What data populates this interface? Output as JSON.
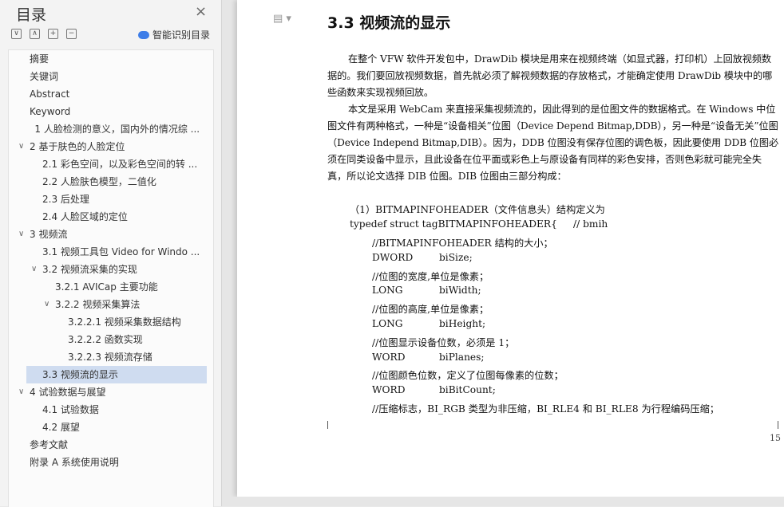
{
  "sidebar": {
    "title": "目录",
    "close_icon": "close-icon",
    "tools": [
      "expand-icon",
      "collapse-icon",
      "plus-icon",
      "minus-icon"
    ],
    "smart_label": "智能识别目录",
    "items": [
      {
        "label": "摘要",
        "level": 0,
        "arrow": ""
      },
      {
        "label": "关键词",
        "level": 0,
        "arrow": ""
      },
      {
        "label": "Abstract",
        "level": 0,
        "arrow": ""
      },
      {
        "label": "Keyword",
        "level": 0,
        "arrow": ""
      },
      {
        "label": "1 人脸检测的意义，国内外的情况综 ...",
        "level": 0.4,
        "arrow": ""
      },
      {
        "label": "2  基于肤色的人脸定位",
        "level": 0,
        "arrow": "∨"
      },
      {
        "label": "2.1 彩色空间，以及彩色空间的转 ...",
        "level": 1,
        "arrow": ""
      },
      {
        "label": "2.2 人脸肤色模型，二值化",
        "level": 1,
        "arrow": ""
      },
      {
        "label": "2.3 后处理",
        "level": 1,
        "arrow": ""
      },
      {
        "label": "2.4 人脸区域的定位",
        "level": 1,
        "arrow": ""
      },
      {
        "label": "3 视频流",
        "level": 0,
        "arrow": "∨"
      },
      {
        "label": "3.1  视频工具包 Video for Windo ...",
        "level": 1,
        "arrow": ""
      },
      {
        "label": "3.2 视频流采集的实现",
        "level": 1,
        "arrow": "∨"
      },
      {
        "label": "3.2.1 AVICap 主要功能",
        "level": 2,
        "arrow": ""
      },
      {
        "label": "3.2.2  视频采集算法",
        "level": 2,
        "arrow": "∨"
      },
      {
        "label": "3.2.2.1 视频采集数据结构",
        "level": 3,
        "arrow": ""
      },
      {
        "label": "3.2.2.2 函数实现",
        "level": 3,
        "arrow": ""
      },
      {
        "label": "3.2.2.3  视频流存储",
        "level": 3,
        "arrow": ""
      },
      {
        "label": "3.3 视频流的显示",
        "level": 1,
        "arrow": "",
        "selected": true
      },
      {
        "label": "4 试验数据与展望",
        "level": 0,
        "arrow": "∨"
      },
      {
        "label": "4.1 试验数据",
        "level": 1,
        "arrow": ""
      },
      {
        "label": "4.2 展望",
        "level": 1,
        "arrow": ""
      },
      {
        "label": "参考文献",
        "level": 0,
        "arrow": ""
      },
      {
        "label": "附录 A  系统使用说明",
        "level": 0,
        "arrow": ""
      }
    ]
  },
  "document": {
    "heading": "3.3 视频流的显示",
    "doc_icon": "document-icon",
    "para1": "在整个 VFW 软件开发包中，DrawDib 模块是用来在视频终端（如显式器，打印机）上回放视频数据的。我们要回放视频数据，首先就必须了解视频数据的存放格式，才能确定使用 DrawDib 模块中的哪些函数来实现视频回放。",
    "para2": "本文是采用 WebCam 来直接采集视频流的，因此得到的是位图文件的数据格式。在 Windows 中位图文件有两种格式，一种是“设备相关”位图（Device Depend Bitmap,DDB），另一种是“设备无关”位图（Device Independ Bitmap,DIB）。因为，DDB 位图没有保存位图的调色板，因此要使用 DDB 位图必须在同类设备中显示，且此设备在位平面或彩色上与原设备有同样的彩色安排，否则色彩就可能完全失真，所以论文选择 DIB 位图。DIB 位图由三部分构成：",
    "line_section": "（1）BITMAPINFOHEADER（文件信息头）结构定义为",
    "line_typedef": "typedef struct tagBITMAPINFOHEADER{",
    "line_typedef_comment": "// bmih",
    "code": [
      {
        "comment": "//BITMAPINFOHEADER 结构的大小；",
        "type": "",
        "name": ""
      },
      {
        "comment": "",
        "type": "DWORD",
        "name": "biSize;"
      },
      {
        "comment": "//位图的宽度,单位是像素；",
        "type": "",
        "name": ""
      },
      {
        "comment": "",
        "type": "LONG",
        "name": "biWidth;"
      },
      {
        "comment": "//位图的高度,单位是像素；",
        "type": "",
        "name": ""
      },
      {
        "comment": "",
        "type": "LONG",
        "name": "biHeight;"
      },
      {
        "comment": "//位图显示设备位数，必须是 1；",
        "type": "",
        "name": ""
      },
      {
        "comment": "",
        "type": "WORD",
        "name": "biPlanes;"
      },
      {
        "comment": "//位图颜色位数，定义了位图每像素的位数；",
        "type": "",
        "name": ""
      },
      {
        "comment": "",
        "type": "WORD",
        "name": "biBitCount;"
      },
      {
        "comment": "//压缩标志，BI_RGB 类型为非压缩，BI_RLE4 和 BI_RLE8 为行程编码压缩；",
        "type": "",
        "name": ""
      }
    ],
    "page_number": "15"
  }
}
